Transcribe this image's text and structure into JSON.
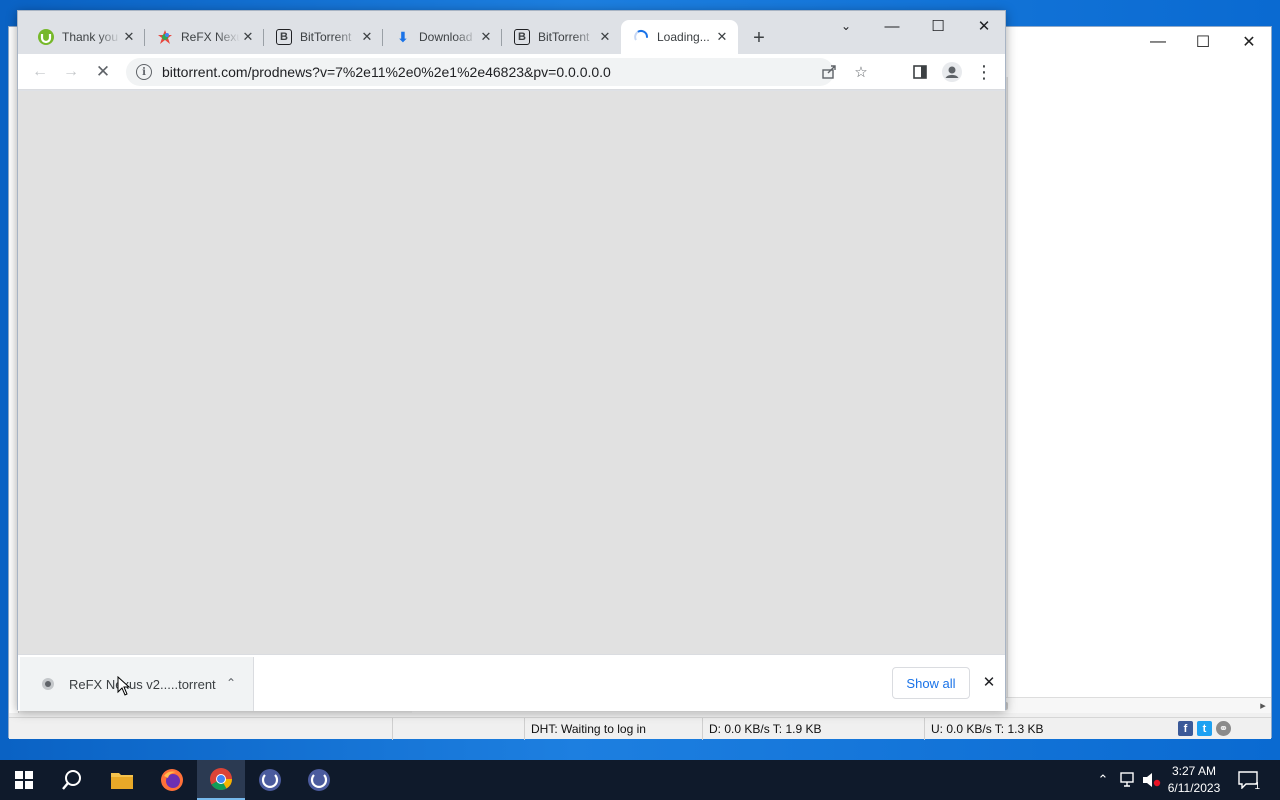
{
  "browser": {
    "tabs": [
      {
        "title": "Thank you",
        "icon": "utorrent-icon",
        "fade": true,
        "active": false
      },
      {
        "title": "ReFX Nexus",
        "icon": "refx-icon",
        "fade": true,
        "active": false
      },
      {
        "title": "BitTorrent",
        "icon": "bittorrent-b-icon",
        "fade": true,
        "active": false
      },
      {
        "title": "Download",
        "icon": "download-icon",
        "fade": true,
        "active": false
      },
      {
        "title": "BitTorrent",
        "icon": "bittorrent-b-icon",
        "fade": true,
        "active": false
      },
      {
        "title": "Loading...",
        "icon": "loading-spinner-icon",
        "fade": false,
        "active": true
      }
    ],
    "url": "bittorrent.com/prodnews?v=7%2e11%2e0%2e1%2e46823&pv=0.0.0.0.0",
    "download_bar": {
      "file_name": "ReFX Nexus v2.....torrent",
      "show_all_label": "Show all"
    }
  },
  "background_app": {
    "status": {
      "dht": "DHT: Waiting to log in",
      "download": "D: 0.0 KB/s T: 1.9 KB",
      "upload": "U: 0.0 KB/s T: 1.3 KB"
    }
  },
  "taskbar": {
    "apps": [
      "start-icon",
      "search-icon",
      "file-explorer-icon",
      "firefox-icon",
      "chrome-icon",
      "bittorrent-icon",
      "bittorrent-icon"
    ],
    "clock_time": "3:27 AM",
    "clock_date": "6/11/2023",
    "notification_count": "1"
  },
  "colors": {
    "accent": "#1a73e8",
    "taskbar": "#0f1a2b",
    "desktop": "#0a74d2"
  }
}
